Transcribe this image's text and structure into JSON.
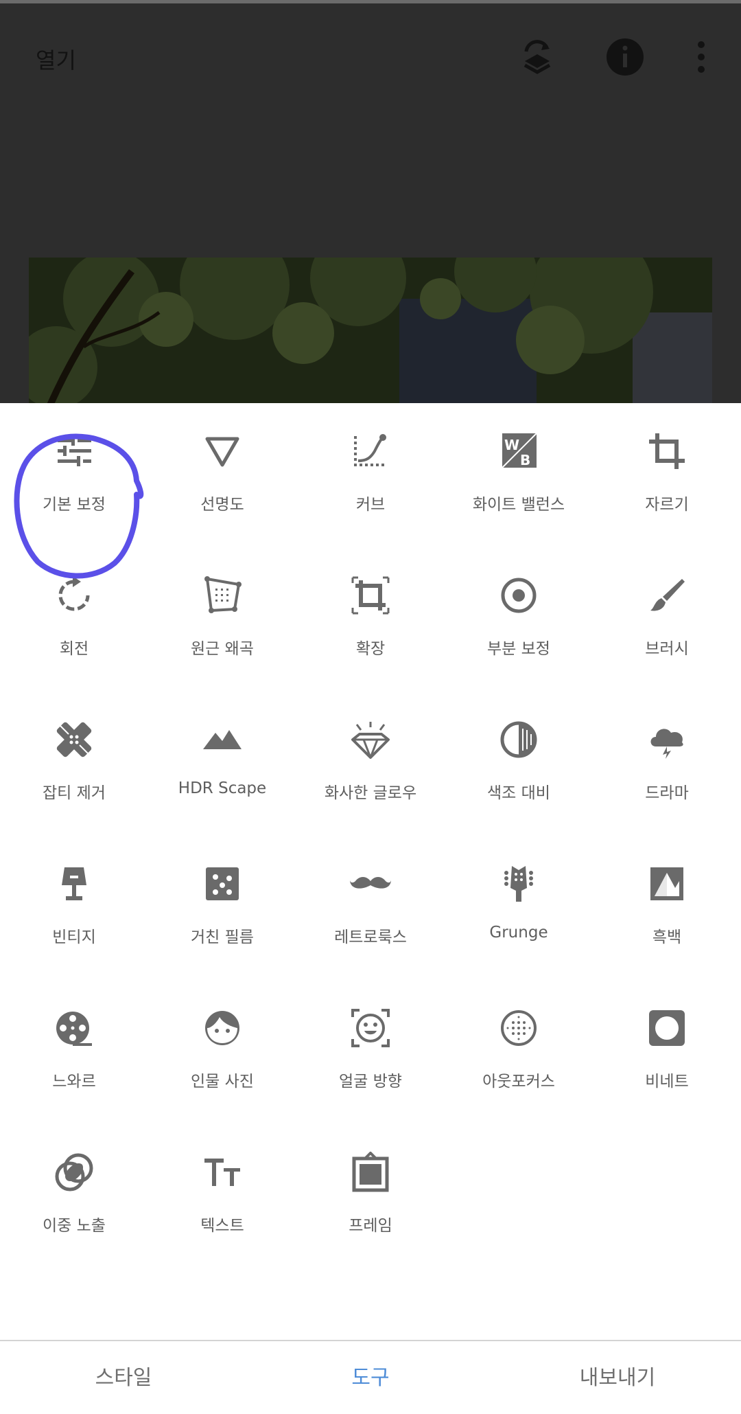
{
  "header": {
    "open_label": "열기"
  },
  "tools": [
    {
      "label": "기본 보정",
      "icon": "tune-sliders-icon"
    },
    {
      "label": "선명도",
      "icon": "details-triangle-icon"
    },
    {
      "label": "커브",
      "icon": "curves-icon"
    },
    {
      "label": "화이트 밸런스",
      "icon": "white-balance-icon"
    },
    {
      "label": "자르기",
      "icon": "crop-icon"
    },
    {
      "label": "회전",
      "icon": "rotate-icon"
    },
    {
      "label": "원근 왜곡",
      "icon": "perspective-icon"
    },
    {
      "label": "확장",
      "icon": "expand-icon"
    },
    {
      "label": "부분 보정",
      "icon": "selective-icon"
    },
    {
      "label": "브러시",
      "icon": "brush-icon"
    },
    {
      "label": "잡티 제거",
      "icon": "healing-bandage-icon"
    },
    {
      "label": "HDR Scape",
      "icon": "mountains-icon"
    },
    {
      "label": "화사한 글로우",
      "icon": "diamond-glow-icon"
    },
    {
      "label": "색조 대비",
      "icon": "tonal-contrast-icon"
    },
    {
      "label": "드라마",
      "icon": "storm-cloud-icon"
    },
    {
      "label": "빈티지",
      "icon": "lamp-icon"
    },
    {
      "label": "거친 필름",
      "icon": "grainy-film-icon"
    },
    {
      "label": "레트로룩스",
      "icon": "mustache-icon"
    },
    {
      "label": "Grunge",
      "icon": "guitar-head-icon"
    },
    {
      "label": "흑백",
      "icon": "black-white-icon"
    },
    {
      "label": "느와르",
      "icon": "film-reel-icon"
    },
    {
      "label": "인물 사진",
      "icon": "face-icon"
    },
    {
      "label": "얼굴 방향",
      "icon": "face-pose-icon"
    },
    {
      "label": "아웃포커스",
      "icon": "lens-blur-icon"
    },
    {
      "label": "비네트",
      "icon": "vignette-icon"
    },
    {
      "label": "이중 노출",
      "icon": "double-exposure-icon"
    },
    {
      "label": "텍스트",
      "icon": "text-icon"
    },
    {
      "label": "프레임",
      "icon": "frame-icon"
    }
  ],
  "nav": {
    "styles": "스타일",
    "tools": "도구",
    "export": "내보내기"
  },
  "colors": {
    "icon": "#6a6a6a",
    "active_tab": "#4e8cd7",
    "highlight": "#5b50e8"
  }
}
